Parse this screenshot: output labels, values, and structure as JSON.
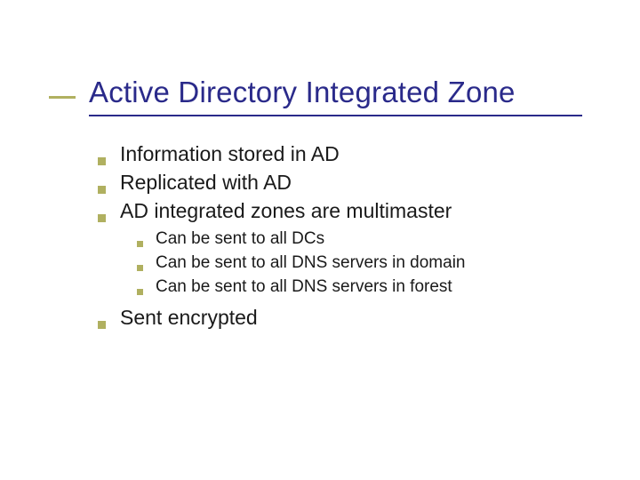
{
  "title": "Active Directory Integrated Zone",
  "bullets": [
    {
      "text": "Information stored in AD"
    },
    {
      "text": "Replicated with AD"
    },
    {
      "text": "AD integrated zones are multimaster"
    }
  ],
  "sub_bullets": [
    {
      "text": "Can be sent to all DCs"
    },
    {
      "text": "Can be sent to all DNS servers in domain"
    },
    {
      "text": "Can be sent to all DNS servers in forest"
    }
  ],
  "bullet_last": {
    "text": "Sent encrypted"
  }
}
